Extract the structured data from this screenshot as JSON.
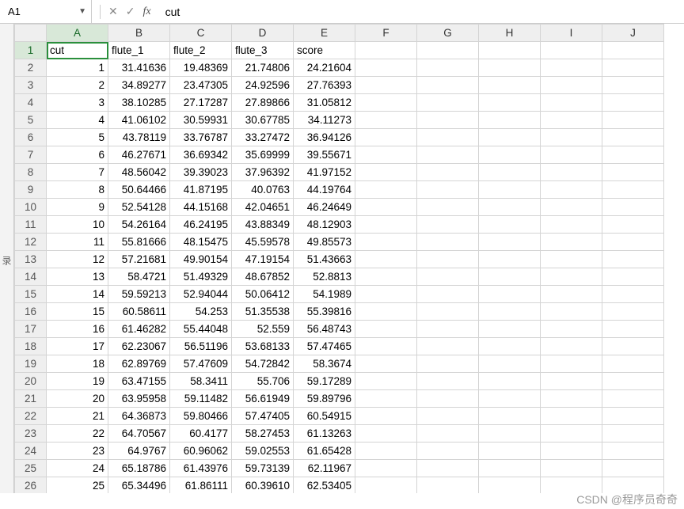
{
  "formula_bar": {
    "name_box": "A1",
    "formula_value": "cut"
  },
  "left_strip_label": "录",
  "columns": [
    "A",
    "B",
    "C",
    "D",
    "E",
    "F",
    "G",
    "H",
    "I",
    "J"
  ],
  "active_cell": {
    "col": "A",
    "row": 1
  },
  "headers": [
    "cut",
    "flute_1",
    "flute_2",
    "flute_3",
    "score"
  ],
  "rows": [
    {
      "n": 1,
      "cut": 1,
      "f1": "31.41636",
      "f2": "19.48369",
      "f3": "21.74806",
      "sc": "24.21604"
    },
    {
      "n": 2,
      "cut": 2,
      "f1": "34.89277",
      "f2": "23.47305",
      "f3": "24.92596",
      "sc": "27.76393"
    },
    {
      "n": 3,
      "cut": 3,
      "f1": "38.10285",
      "f2": "27.17287",
      "f3": "27.89866",
      "sc": "31.05812"
    },
    {
      "n": 4,
      "cut": 4,
      "f1": "41.06102",
      "f2": "30.59931",
      "f3": "30.67785",
      "sc": "34.11273"
    },
    {
      "n": 5,
      "cut": 5,
      "f1": "43.78119",
      "f2": "33.76787",
      "f3": "33.27472",
      "sc": "36.94126"
    },
    {
      "n": 6,
      "cut": 6,
      "f1": "46.27671",
      "f2": "36.69342",
      "f3": "35.69999",
      "sc": "39.55671"
    },
    {
      "n": 7,
      "cut": 7,
      "f1": "48.56042",
      "f2": "39.39023",
      "f3": "37.96392",
      "sc": "41.97152"
    },
    {
      "n": 8,
      "cut": 8,
      "f1": "50.64466",
      "f2": "41.87195",
      "f3": "40.0763",
      "sc": "44.19764"
    },
    {
      "n": 9,
      "cut": 9,
      "f1": "52.54128",
      "f2": "44.15168",
      "f3": "42.04651",
      "sc": "46.24649"
    },
    {
      "n": 10,
      "cut": 10,
      "f1": "54.26164",
      "f2": "46.24195",
      "f3": "43.88349",
      "sc": "48.12903"
    },
    {
      "n": 11,
      "cut": 11,
      "f1": "55.81666",
      "f2": "48.15475",
      "f3": "45.59578",
      "sc": "49.85573"
    },
    {
      "n": 12,
      "cut": 12,
      "f1": "57.21681",
      "f2": "49.90154",
      "f3": "47.19154",
      "sc": "51.43663"
    },
    {
      "n": 13,
      "cut": 13,
      "f1": "58.4721",
      "f2": "51.49329",
      "f3": "48.67852",
      "sc": "52.8813"
    },
    {
      "n": 14,
      "cut": 14,
      "f1": "59.59213",
      "f2": "52.94044",
      "f3": "50.06412",
      "sc": "54.1989"
    },
    {
      "n": 15,
      "cut": 15,
      "f1": "60.58611",
      "f2": "54.253",
      "f3": "51.35538",
      "sc": "55.39816"
    },
    {
      "n": 16,
      "cut": 16,
      "f1": "61.46282",
      "f2": "55.44048",
      "f3": "52.559",
      "sc": "56.48743"
    },
    {
      "n": 17,
      "cut": 17,
      "f1": "62.23067",
      "f2": "56.51196",
      "f3": "53.68133",
      "sc": "57.47465"
    },
    {
      "n": 18,
      "cut": 18,
      "f1": "62.89769",
      "f2": "57.47609",
      "f3": "54.72842",
      "sc": "58.3674"
    },
    {
      "n": 19,
      "cut": 19,
      "f1": "63.47155",
      "f2": "58.3411",
      "f3": "55.706",
      "sc": "59.17289"
    },
    {
      "n": 20,
      "cut": 20,
      "f1": "63.95958",
      "f2": "59.11482",
      "f3": "56.61949",
      "sc": "59.89796"
    },
    {
      "n": 21,
      "cut": 21,
      "f1": "64.36873",
      "f2": "59.80466",
      "f3": "57.47405",
      "sc": "60.54915"
    },
    {
      "n": 22,
      "cut": 22,
      "f1": "64.70567",
      "f2": "60.4177",
      "f3": "58.27453",
      "sc": "61.13263"
    },
    {
      "n": 23,
      "cut": 23,
      "f1": "64.9767",
      "f2": "60.96062",
      "f3": "59.02553",
      "sc": "61.65428"
    },
    {
      "n": 24,
      "cut": 24,
      "f1": "65.18786",
      "f2": "61.43976",
      "f3": "59.73139",
      "sc": "62.11967"
    },
    {
      "n": 25,
      "cut": 25,
      "f1": "65.34496",
      "f2": "61.86111",
      "f3": "60.39610",
      "sc": "62.53405"
    }
  ],
  "watermark": "CSDN @程序员奇奇"
}
